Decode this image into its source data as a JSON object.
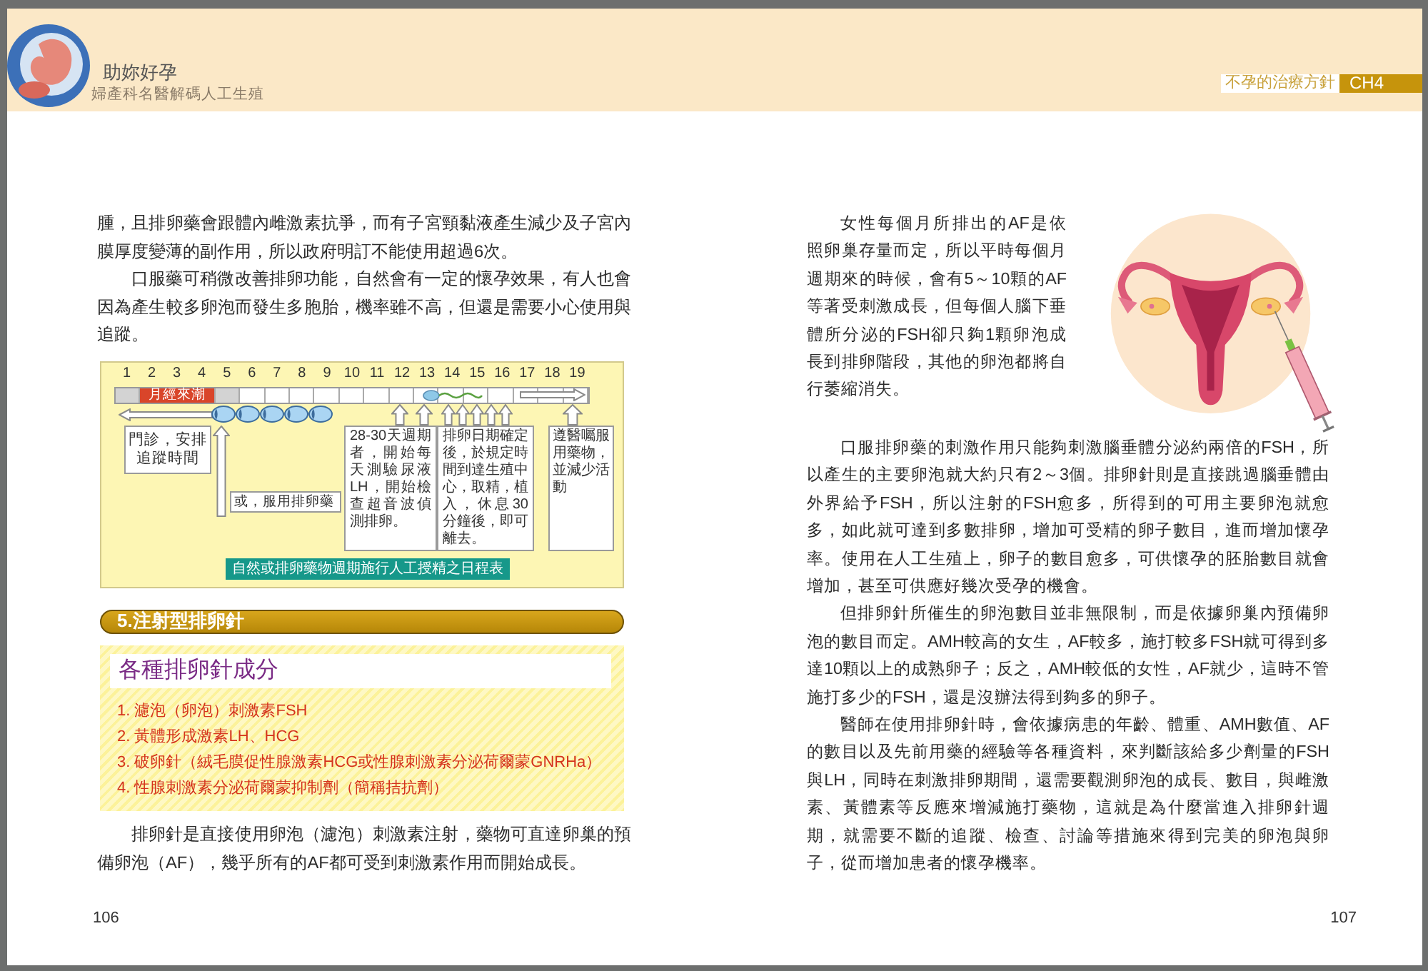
{
  "header": {
    "title": "助妳好孕",
    "subtitle": "婦產科名醫解碼人工生殖",
    "section_tag": "不孕的治療方針",
    "chapter_tag": "CH4"
  },
  "left_page": {
    "paragraphs_top": [
      {
        "text": "腫，且排卵藥會跟體內雌激素抗爭，而有子宮頸黏液產生減少及子宮內膜厚度變薄的副作用，所以政府明訂不能使用超過6次。",
        "indent": false
      },
      {
        "text": "口服藥可稍微改善排卵功能，自然會有一定的懷孕效果，有人也會因為產生較多卵泡而發生多胞胎，機率雖不高，但還是需要小心使用與追蹤。",
        "indent": true
      }
    ],
    "schedule": {
      "days": [
        "1",
        "2",
        "3",
        "4",
        "5",
        "6",
        "7",
        "8",
        "9",
        "10",
        "11",
        "12",
        "13",
        "14",
        "15",
        "16",
        "17",
        "18",
        "19"
      ],
      "period_label": "月經來潮",
      "notes": [
        {
          "text": "門診，安排追蹤時間"
        },
        {
          "text": "或，服用排卵藥"
        },
        {
          "text": "28-30天週期者，開始每天測驗尿液LH，開始檢查超音波偵測排卵。"
        },
        {
          "text": "排卵日期確定後，於規定時間到達生殖中心，取精，植入，休息30分鐘後，即可離去。"
        },
        {
          "text": "遵醫囑服用藥物，並減少活動"
        }
      ],
      "caption": "自然或排卵藥物週期施行人工授精之日程表"
    },
    "section_heading": "5.注射型排卵針",
    "ingredients_box": {
      "title": "各種排卵針成分",
      "items": [
        "1. 濾泡（卵泡）刺激素FSH",
        "2. 黃體形成激素LH、HCG",
        "3. 破卵針（絨毛膜促性腺激素HCG或性腺刺激素分泌荷爾蒙GNRHa）",
        "4. 性腺刺激素分泌荷爾蒙抑制劑（簡稱拮抗劑）"
      ]
    },
    "paragraphs_bottom": [
      {
        "text": "排卵針是直接使用卵泡（濾泡）刺激素注射，藥物可直達卵巢的預備卵泡（AF），幾乎所有的AF都可受到刺激素作用而開始成長。",
        "indent": true
      }
    ],
    "page_number": "106"
  },
  "right_page": {
    "paragraphs": [
      {
        "text": "女性每個月所排出的AF是依照卵巢存量而定，所以平時每個月週期來的時候，會有5～10顆的AF等著受刺激成長，但每個人腦下垂體所分泌的FSH卻只夠1顆卵泡成長到排卵階段，其他的卵泡都將自行萎縮消失。",
        "indent": true
      },
      {
        "text": "口服排卵藥的刺激作用只能夠刺激腦垂體分泌約兩倍的FSH，所以產生的主要卵泡就大約只有2～3個。排卵針則是直接跳過腦垂體由外界給予FSH，所以注射的FSH愈多，所得到的可用主要卵泡就愈多，如此就可達到多數排卵，增加可受精的卵子數目，進而增加懷孕率。使用在人工生殖上，卵子的數目愈多，可供懷孕的胚胎數目就會增加，甚至可供應好幾次受孕的機會。",
        "indent": true
      },
      {
        "text": "但排卵針所催生的卵泡數目並非無限制，而是依據卵巢內預備卵泡的數目而定。AMH較高的女生，AF較多，施打較多FSH就可得到多達10顆以上的成熟卵子；反之，AMH較低的女性，AF就少，這時不管施打多少的FSH，還是沒辦法得到夠多的卵子。",
        "indent": true
      },
      {
        "text": "醫師在使用排卵針時，會依據病患的年齡、體重、AMH數值、AF的數目以及先前用藥的經驗等各種資料，來判斷該給多少劑量的FSH與LH，同時在刺激排卵期間，還需要觀測卵泡的成長、數目，與雌激素、黃體素等反應來增減施打藥物，這就是為什麼當進入排卵針週期，就需要不斷的追蹤、檢查、討論等措施來得到完美的卵泡與卵子，從而增加患者的懷孕機率。",
        "indent": true
      }
    ],
    "page_number": "107"
  }
}
